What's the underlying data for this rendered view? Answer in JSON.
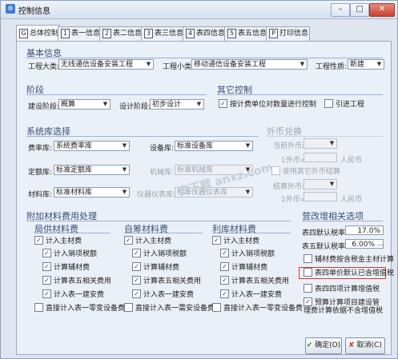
{
  "window": {
    "title": "控制信息"
  },
  "tabs": [
    {
      "num": "G",
      "label": "总体控制"
    },
    {
      "num": "1",
      "label": "表一信息"
    },
    {
      "num": "2",
      "label": "表二信息"
    },
    {
      "num": "3",
      "label": "表三信息"
    },
    {
      "num": "4",
      "label": "表四信息"
    },
    {
      "num": "5",
      "label": "表五信息"
    },
    {
      "num": "P",
      "label": "打印信息"
    }
  ],
  "basic": {
    "title": "基本信息",
    "project_type_label": "工程大类:",
    "project_type_value": "无线通信设备安装工程",
    "project_sub_label": "工程小类:",
    "project_sub_value": "移动通信设备安装工程",
    "project_nature_label": "工程性质:",
    "project_nature_value": "新建"
  },
  "stage": {
    "title": "阶段",
    "build_label": "建设阶段:",
    "build_value": "概算",
    "design_label": "设计阶段:",
    "design_value": "初步设计"
  },
  "other": {
    "title": "其它控制",
    "design_unit_label": "按计费单位对数量进行控制",
    "import_label": "引进工程"
  },
  "system": {
    "title": "系统库选择",
    "rate_label": "费率库:",
    "rate_value": "系统费率库",
    "device_label": "设备库:",
    "device_value": "标准设备库",
    "quota_label": "定额库:",
    "quota_value": "标准定额库",
    "machine_label": "机械库:",
    "machine_value": "标准机械库",
    "material_label": "材料库:",
    "material_value": "标准材料库",
    "instrument_label": "仪器仪表库:",
    "instrument_value": "标准仪器仪表库"
  },
  "foreign": {
    "title": "外币兑换",
    "currency_label": "当前外币:",
    "one_label": "1外币=",
    "rmb_label": "人民币",
    "use_other_label": "使用其它外币结算",
    "settle_label": "结算外币:",
    "one_label2": "1外币=",
    "rmb_label2": "人民币"
  },
  "extra": {
    "title": "附加材料费用处理",
    "local": {
      "title": "局供材料费",
      "items": [
        "计入主材费",
        "计入销项税额",
        "计算辅材费",
        "计算表五相关费用",
        "计入表一建安费",
        "直接计入表一零变设备费"
      ]
    },
    "self": {
      "title": "自筹材料费",
      "items": [
        "计入主材费",
        "计入销项税额",
        "计算辅材费",
        "计算表五相关费用",
        "计入表一建安费",
        "直接计入表一需安设备费"
      ]
    },
    "stock": {
      "title": "利库材料费",
      "items": [
        "计入主材费",
        "计入销项税额",
        "计算辅材费",
        "计算表五相关费用",
        "计入表一建安费",
        "直接计入表一零变设备费"
      ]
    }
  },
  "vat": {
    "title": "营改增相关选项",
    "t4_label": "表四默认税率:",
    "t4_value": "17.0%",
    "t5_label": "表五默认税率:",
    "t5_value": "6.00%",
    "aux_label": "辅材费按含税金主材计算",
    "price_label": "表四单价默认已含增值税",
    "t4_calc_label": "表四四项计算增值税",
    "budget_label": "预算计算项目建设管理费计算依据不含增值税"
  },
  "buttons": {
    "ok": "确定(O)",
    "cancel": "取消(C)"
  },
  "watermark": "安下载 anxz.com"
}
